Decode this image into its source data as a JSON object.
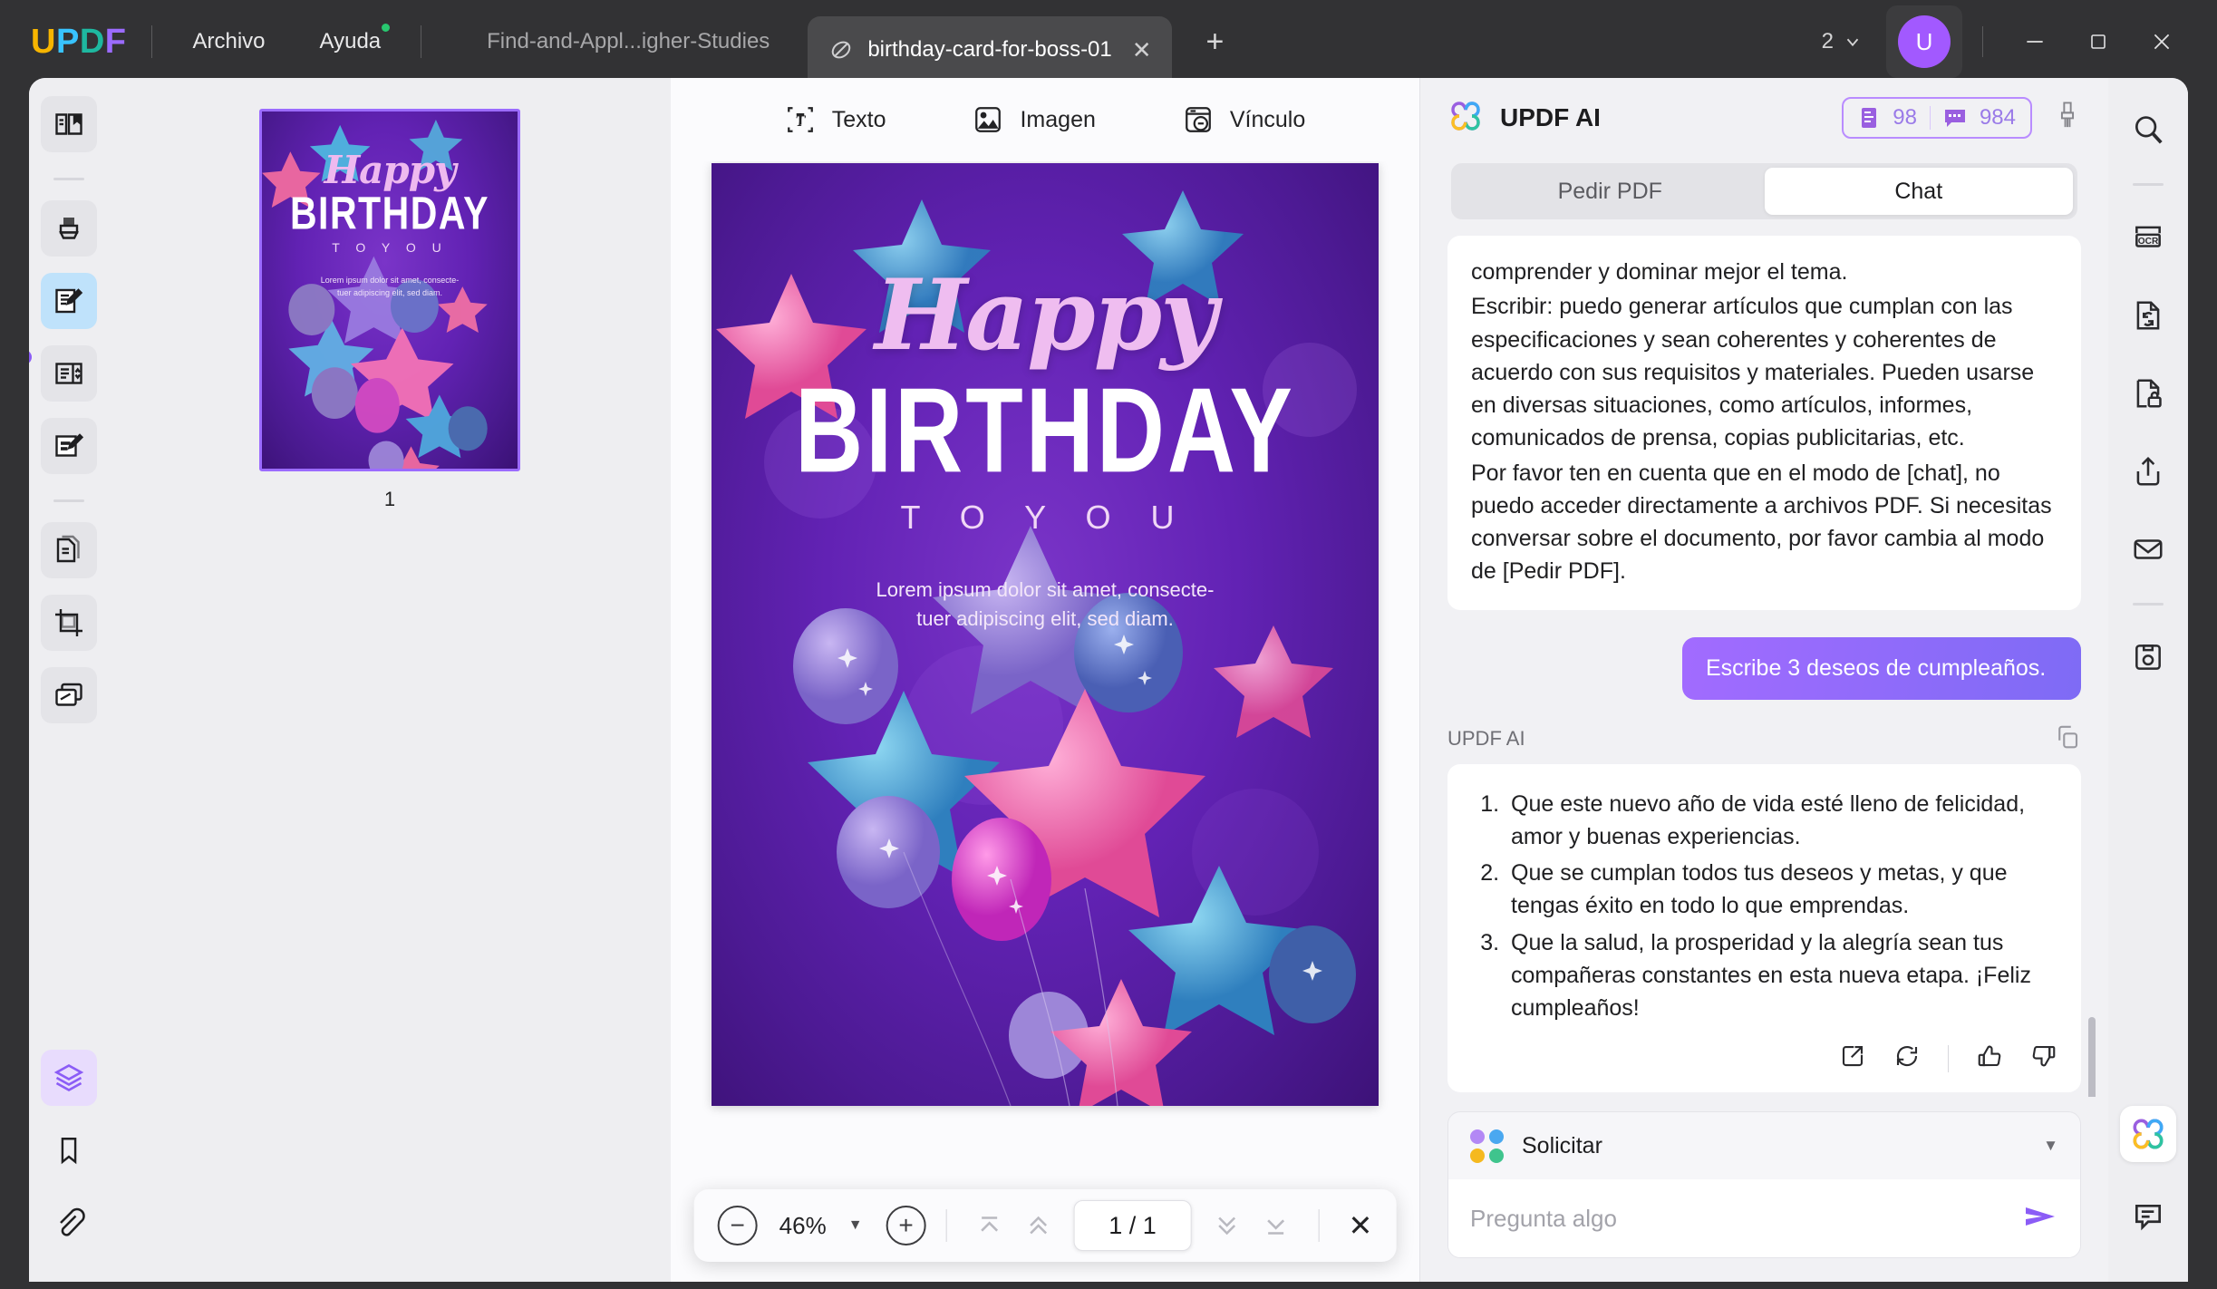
{
  "titlebar": {
    "logo": "UPDF",
    "logo_letters": [
      "U",
      "P",
      "D",
      "F"
    ],
    "menu": [
      {
        "label": "Archivo",
        "badge": false
      },
      {
        "label": "Ayuda",
        "badge": true
      }
    ],
    "inactive_tab": "Find-and-Appl...igher-Studies",
    "active_tab": "birthday-card-for-boss-01",
    "tab_close": "✕",
    "new_tab": "+",
    "window_count": "2",
    "avatar_letter": "U",
    "minimize": "—",
    "maximize": "☐",
    "close": "✕"
  },
  "left_rail": {
    "items": [
      {
        "name": "reader-mode-icon",
        "state": "normal"
      },
      {
        "name": "highlighter-icon",
        "state": "normal"
      },
      {
        "name": "edit-pdf-icon",
        "state": "active"
      },
      {
        "name": "form-fields-icon",
        "state": "normal"
      },
      {
        "name": "comment-edit-icon",
        "state": "normal"
      },
      {
        "name": "organize-pages-icon",
        "state": "normal"
      },
      {
        "name": "crop-icon",
        "state": "normal"
      },
      {
        "name": "batch-icon",
        "state": "normal"
      },
      {
        "name": "layers-icon",
        "state": "active-purple"
      },
      {
        "name": "bookmark-icon",
        "state": "plain"
      },
      {
        "name": "attachment-icon",
        "state": "plain"
      }
    ]
  },
  "thumbnails": {
    "pages": [
      {
        "number": "1",
        "selected": true
      }
    ]
  },
  "edit_toolbar": {
    "items": [
      {
        "icon": "text-box-icon",
        "label": "Texto"
      },
      {
        "icon": "image-icon",
        "label": "Imagen"
      },
      {
        "icon": "link-icon",
        "label": "Vínculo"
      }
    ]
  },
  "document": {
    "script_title": "Happy",
    "headline": "BIRTHDAY",
    "subhead": "T O   Y O U",
    "body_line1": "Lorem ipsum dolor sit amet, consecte-",
    "body_line2": "tuer adipiscing elit, sed diam."
  },
  "float_bar": {
    "zoom_out": "−",
    "zoom_level": "46%",
    "zoom_caret": "▼",
    "zoom_in": "+",
    "first_page": "first-page-icon",
    "prev_page": "prev-page-icon",
    "page_indicator": "1 / 1",
    "next_page": "next-page-icon",
    "last_page": "last-page-icon",
    "close": "✕"
  },
  "ai_panel": {
    "title": "UPDF AI",
    "credits": {
      "documents": "98",
      "messages": "984"
    },
    "brush_icon": "brush-icon",
    "tabs": [
      {
        "label": "Pedir PDF",
        "active": false
      },
      {
        "label": "Chat",
        "active": true
      }
    ],
    "messages": [
      {
        "role": "assistant",
        "paragraphs": [
          "comprender y dominar mejor el tema.",
          "Escribir: puedo generar artículos que cumplan con las especificaciones y sean coherentes y coherentes de acuerdo con sus requisitos y materiales. Pueden usarse en diversas situaciones, como artículos, informes, comunicados de prensa, copias publicitarias, etc.",
          "Por favor ten en cuenta que en el modo de [chat], no puedo acceder directamente a archivos PDF. Si necesitas conversar sobre el documento, por favor cambia al modo de [Pedir PDF]."
        ]
      },
      {
        "role": "user",
        "text": "Escribe 3 deseos de cumpleaños."
      },
      {
        "role": "assistant",
        "sender_label": "UPDF AI",
        "list": [
          "Que este nuevo año de vida esté lleno de felicidad, amor y buenas experiencias.",
          "Que se cumplan todos tus deseos y metas, y que tengas éxito en todo lo que emprendas.",
          "Que la salud, la prosperidad y la alegría sean tus compañeras constantes en esta nueva etapa. ¡Feliz cumpleaños!"
        ],
        "actions": [
          "export-icon",
          "regenerate-icon",
          "thumbs-up-icon",
          "thumbs-down-icon"
        ]
      }
    ],
    "compose": {
      "mode_label": "Solicitar",
      "mode_caret": "▼",
      "placeholder": "Pregunta algo",
      "send_icon": "send-icon"
    }
  },
  "right_rail": {
    "items": [
      {
        "name": "search-icon"
      },
      {
        "name": "ocr-icon"
      },
      {
        "name": "convert-icon"
      },
      {
        "name": "protect-icon"
      },
      {
        "name": "share-icon"
      },
      {
        "name": "email-icon"
      },
      {
        "name": "save-as-icon"
      },
      {
        "name": "updf-ai-icon"
      },
      {
        "name": "comment-icon"
      }
    ]
  },
  "colors": {
    "accent_purple": "#a259ff",
    "titlebar_bg": "#323234",
    "panel_bg": "#eeeef1",
    "viewer_bg": "#fbfbfd",
    "active_tab_blue": "#bfe2fb",
    "credit_border": "#b98cff"
  }
}
